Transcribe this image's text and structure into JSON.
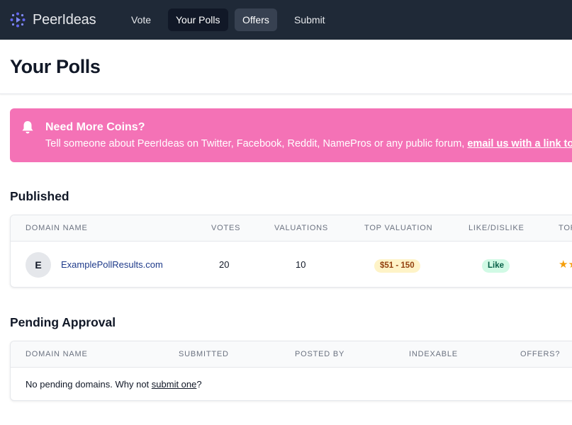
{
  "nav": {
    "brand": "PeerIdeas",
    "links": [
      {
        "label": "Vote"
      },
      {
        "label": "Your Polls"
      },
      {
        "label": "Offers"
      },
      {
        "label": "Submit"
      }
    ]
  },
  "page": {
    "title": "Your Polls"
  },
  "banner": {
    "title": "Need More Coins?",
    "text": "Tell someone about PeerIdeas on Twitter, Facebook, Reddit, NamePros or any public forum, ",
    "link": "email us with a link to",
    "icon": "bell-icon"
  },
  "published": {
    "title": "Published",
    "columns": [
      "Domain Name",
      "Votes",
      "Valuations",
      "Top Valuation",
      "Like/Dislike",
      "Top"
    ],
    "rows": [
      {
        "avatar": "E",
        "domain": "ExamplePollResults.com",
        "votes": "20",
        "valuations": "10",
        "top_valuation": "$51 - 150",
        "like": "Like",
        "stars": "★★"
      }
    ]
  },
  "pending": {
    "title": "Pending Approval",
    "columns": [
      "Domain Name",
      "Submitted",
      "Posted By",
      "Indexable",
      "Offers?"
    ],
    "empty_text": "No pending domains. Why not ",
    "empty_link": "submit one",
    "empty_suffix": "?"
  },
  "colors": {
    "nav_bg": "#1f2937",
    "banner_bg": "#f472b6",
    "link": "#1e3a8a",
    "badge_yellow": "#fef3c7",
    "badge_green": "#d1fae5",
    "star": "#f59e0b"
  }
}
